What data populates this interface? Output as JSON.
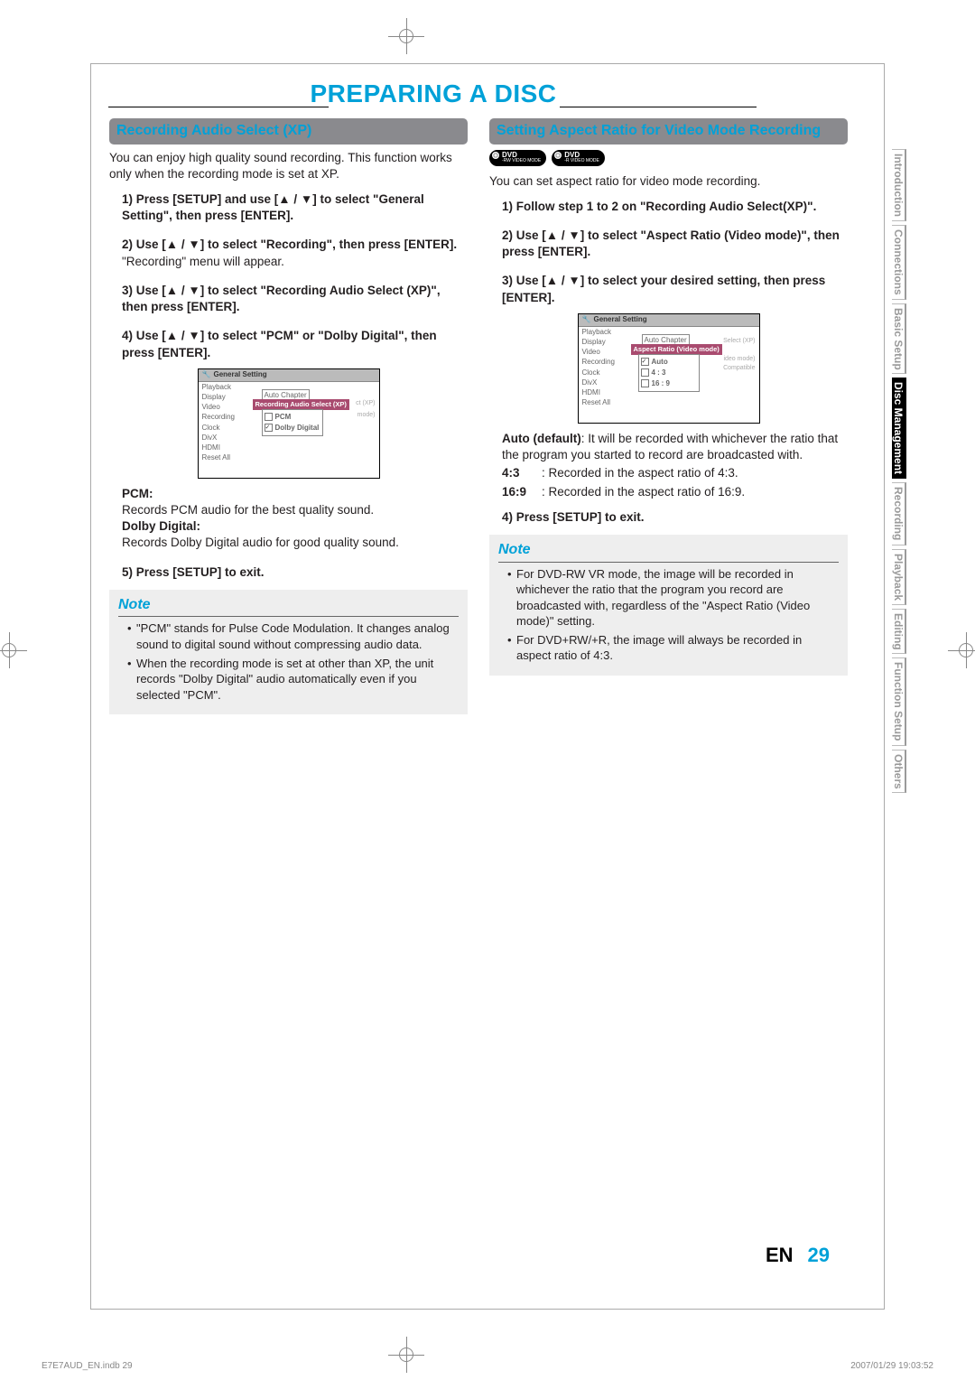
{
  "page_title": "PREPARING A DISC",
  "left": {
    "heading": "Recording Audio Select (XP)",
    "intro": "You can enjoy high quality sound recording. This function works only when the recording mode is set at XP.",
    "steps": {
      "s1": "1) Press [SETUP] and use [▲ / ▼] to select \"General Setting\", then press [ENTER].",
      "s2": "2) Use [▲ / ▼] to select \"Recording\", then press [ENTER].",
      "s2b": "\"Recording\" menu will appear.",
      "s3": "3) Use [▲ / ▼] to select \"Recording Audio Select (XP)\", then press [ENTER].",
      "s4": "4) Use [▲ / ▼] to select \"PCM\" or \"Dolby Digital\", then press [ENTER].",
      "s5": "5) Press [SETUP] to exit."
    },
    "osd": {
      "title": "General Setting",
      "menu": [
        "Playback",
        "Display",
        "Video",
        "Recording",
        "Clock",
        "DivX",
        "HDMI",
        "Reset All"
      ],
      "popup": "Auto Chapter",
      "sel": "Recording Audio Select (XP)",
      "fade_right": [
        "ct (XP)",
        "mode)"
      ],
      "options": [
        {
          "label": "PCM",
          "checked": false
        },
        {
          "label": "Dolby Digital",
          "checked": true
        }
      ]
    },
    "pcm_h": "PCM:",
    "pcm_t": "Records PCM audio for the best quality sound.",
    "dd_h": "Dolby Digital:",
    "dd_t": "Records Dolby Digital audio for good quality sound.",
    "note_title": "Note",
    "note_items": [
      "\"PCM\" stands for Pulse Code Modulation. It changes analog sound to digital sound without compressing audio data.",
      "When the recording mode is set at other than XP, the unit records \"Dolby Digital\" audio automatically even if you selected \"PCM\"."
    ]
  },
  "right": {
    "heading": "Setting Aspect Ratio for Video Mode Recording",
    "dvd_badges": [
      {
        "top": "DVD",
        "sub": "-RW VIDEO MODE"
      },
      {
        "top": "DVD",
        "sub": "-R VIDEO MODE"
      }
    ],
    "intro": "You can set aspect ratio for video mode recording.",
    "steps": {
      "s1": "1) Follow step 1 to 2 on \"Recording Audio Select(XP)\".",
      "s2": "2) Use [▲ / ▼] to select \"Aspect Ratio (Video mode)\", then press [ENTER].",
      "s3": "3) Use [▲ / ▼] to select your desired setting, then press [ENTER].",
      "s4": "4) Press [SETUP] to exit."
    },
    "osd": {
      "title": "General Setting",
      "menu": [
        "Playback",
        "Display",
        "Video",
        "Recording",
        "Clock",
        "DivX",
        "HDMI",
        "Reset All"
      ],
      "popup": "Auto Chapter",
      "sel": "Aspect Ratio (Video mode)",
      "fade_right": [
        "Select (XP)",
        "ideo mode)",
        "Compatible"
      ],
      "options": [
        {
          "label": "Auto",
          "checked": true
        },
        {
          "label": "4 : 3",
          "checked": false
        },
        {
          "label": "16 : 9",
          "checked": false
        }
      ]
    },
    "auto_h": "Auto (default)",
    "auto_t": ": It will be recorded with whichever the ratio that the program you started to record are broadcasted with.",
    "r43_h": "4:3",
    "r43_t": ":   Recorded in the aspect ratio of 4:3.",
    "r169_h": "16:9",
    "r169_t": ":  Recorded in the aspect ratio of 16:9.",
    "note_title": "Note",
    "note_items": [
      "For DVD-RW VR mode, the image will be recorded in whichever the ratio that the program you record are broadcasted with, regardless of the \"Aspect Ratio (Video mode)\" setting.",
      "For DVD+RW/+R, the image will always be recorded in aspect ratio of 4:3."
    ]
  },
  "tabs": [
    {
      "label": "Introduction",
      "active": false
    },
    {
      "label": "Connections",
      "active": false
    },
    {
      "label": "Basic Setup",
      "active": false
    },
    {
      "label": "Disc Management",
      "active": true
    },
    {
      "label": "Recording",
      "active": false
    },
    {
      "label": "Playback",
      "active": false
    },
    {
      "label": "Editing",
      "active": false
    },
    {
      "label": "Function Setup",
      "active": false
    },
    {
      "label": "Others",
      "active": false
    }
  ],
  "page_num": {
    "en": "EN",
    "num": "29"
  },
  "footer": {
    "left": "E7E7AUD_EN.indb   29",
    "right": "2007/01/29   19:03:52"
  }
}
